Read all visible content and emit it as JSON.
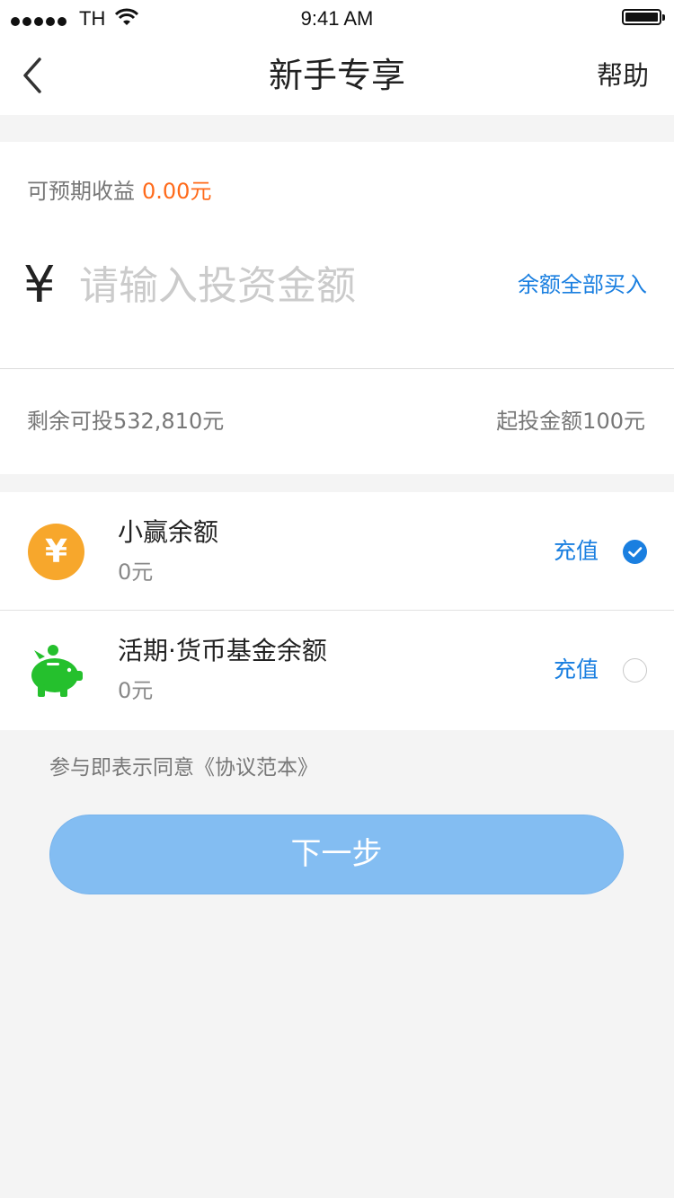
{
  "status_bar": {
    "carrier": "TH",
    "time": "9:41 AM"
  },
  "nav": {
    "title": "新手专享",
    "help_label": "帮助",
    "back_icon": "chevron-left-icon"
  },
  "invest": {
    "expected_label": "可预期收益",
    "expected_value": "0.00元",
    "currency_symbol": "¥",
    "amount_placeholder": "请输入投资金额",
    "buy_all_label": "余额全部买入",
    "remaining_label": "剩余可投532,810元",
    "min_amount_label": "起投金额100元"
  },
  "payment_methods": [
    {
      "name": "小赢余额",
      "balance": "0元",
      "recharge_label": "充值",
      "selected": true,
      "icon": "yen-coin-icon",
      "icon_glyph": "¥",
      "icon_color": "#f7a72c"
    },
    {
      "name": "活期·货币基金余额",
      "balance": "0元",
      "recharge_label": "充值",
      "selected": false,
      "icon": "piggy-bank-icon",
      "icon_color": "#25c02d"
    }
  ],
  "agreement_text": "参与即表示同意《协议范本》",
  "next_button_label": "下一步",
  "colors": {
    "accent": "#1a7fe0",
    "highlight": "#ff6a1a",
    "button": "#83bdf2",
    "background": "#f4f4f4"
  }
}
